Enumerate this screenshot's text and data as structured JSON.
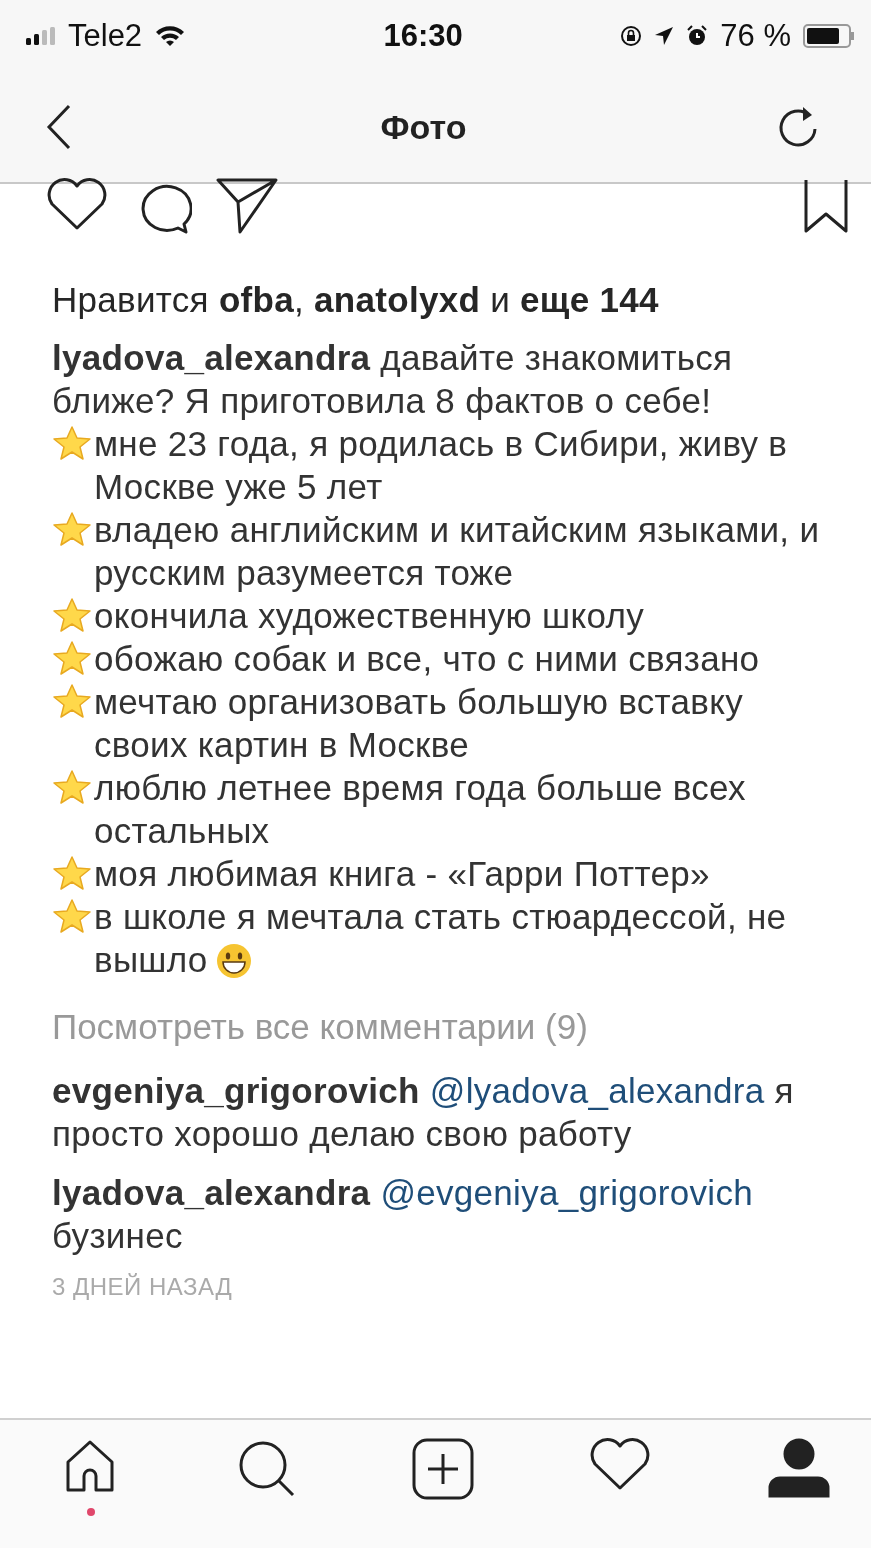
{
  "status_bar": {
    "carrier": "Tele2",
    "time": "16:30",
    "battery": "76 %"
  },
  "nav_bar": {
    "title": "Фото"
  },
  "post": {
    "likes": "Нравится **ofba**, **anatolyxd** и **еще 144**",
    "caption": {
      "author": "lyadova_alexandra",
      "text": "давайте знакомиться ближе? Я приготовила 8 фактов о себе!"
    },
    "facts": [
      {
        "text": "мне 23 года, я родилась в Сибири, живу в Москве уже 5 лет"
      },
      {
        "text": "владею английским и китайским языками, и русским разумеется тоже"
      },
      {
        "text": "окончила художественную школу"
      },
      {
        "text": "обожаю собак и все, что с ними связано"
      },
      {
        "text": "мечтаю организовать большую вставку своих картин в Москве"
      },
      {
        "text": "люблю летнее время года больше всех остальных"
      },
      {
        "text": "моя любимая книга - «Гарри Поттер»"
      },
      {
        "text": "в школе я мечтала стать стюардессой, не вышло",
        "emoji": true
      }
    ],
    "view_all": "Посмотреть все комментарии (9)",
    "comments": [
      {
        "author": "evgeniya_grigorovich",
        "mention": "@lyadova_alexandra",
        "text": "я просто хорошо делаю свою работу"
      },
      {
        "author": "lyadova_alexandra",
        "mention": "@evgeniya_grigorovich",
        "text": "бузинес"
      }
    ],
    "time": "3 ДНЕЙ НАЗАД"
  },
  "tab_bar": [
    {
      "kind": "home",
      "selected": false,
      "badge": true
    },
    {
      "kind": "search",
      "selected": false,
      "badge": false
    },
    {
      "kind": "add",
      "selected": false,
      "badge": false
    },
    {
      "kind": "activity",
      "selected": false,
      "badge": false
    },
    {
      "kind": "profile",
      "selected": true,
      "badge": false
    }
  ]
}
